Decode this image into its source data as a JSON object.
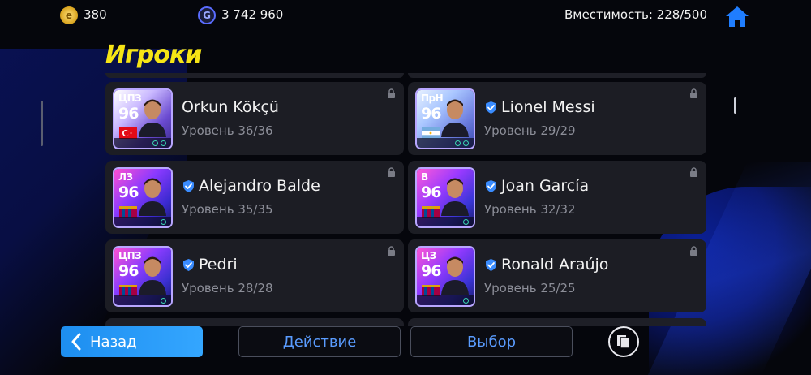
{
  "header": {
    "coins": "380",
    "gp": "3 742 960",
    "capacity": "Вместимость: 228/500"
  },
  "title": "Игроки",
  "players": [
    {
      "position": "ЦПЗ",
      "rating": "96",
      "name": "Orkun Kökçü",
      "level": "Уровень 36/36",
      "verified": false,
      "flag": "turkey"
    },
    {
      "position": "ПрН",
      "rating": "96",
      "name": "Lionel Messi",
      "level": "Уровень 29/29",
      "verified": true,
      "flag": "argentina"
    },
    {
      "position": "ЛЗ",
      "rating": "96",
      "name": "Alejandro Balde",
      "level": "Уровень 35/35",
      "verified": true,
      "flag": "barcelona"
    },
    {
      "position": "В",
      "rating": "96",
      "name": "Joan García",
      "level": "Уровень 32/32",
      "verified": true,
      "flag": "barcelona"
    },
    {
      "position": "ЦПЗ",
      "rating": "96",
      "name": "Pedri",
      "level": "Уровень 28/28",
      "verified": true,
      "flag": "barcelona"
    },
    {
      "position": "ЦЗ",
      "rating": "96",
      "name": "Ronald Araújo",
      "level": "Уровень 25/25",
      "verified": true,
      "flag": "barcelona"
    }
  ],
  "buttons": {
    "back": "Назад",
    "action": "Действие",
    "select": "Выбор"
  },
  "icons": {
    "coin": "efootball-coin-icon",
    "gp": "gp-coin-icon",
    "home": "home-icon",
    "lock": "lock-icon",
    "verified": "shield-check-icon",
    "back": "chevron-left-icon",
    "copy": "copy-icon"
  },
  "colors": {
    "title": "#f6e415",
    "accent": "#34a6ff",
    "verified": "#3a8cff"
  }
}
